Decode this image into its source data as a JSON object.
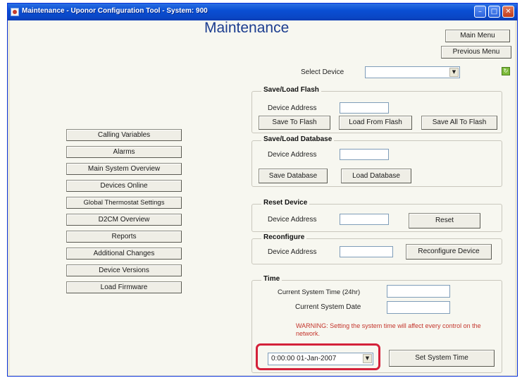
{
  "window": {
    "title": "Maintenance - Uponor Configuration Tool - System: 900"
  },
  "header": {
    "page_title": "Maintenance",
    "main_menu": "Main Menu",
    "previous_menu": "Previous Menu"
  },
  "select_device": {
    "label": "Select Device",
    "value": ""
  },
  "sidebar": {
    "items": [
      {
        "label": "Calling Variables"
      },
      {
        "label": "Alarms"
      },
      {
        "label": "Main System Overview"
      },
      {
        "label": "Devices Online"
      },
      {
        "label": "Global Thermostat Settings"
      },
      {
        "label": "D2CM Overview"
      },
      {
        "label": "Reports"
      },
      {
        "label": "Additional Changes"
      },
      {
        "label": "Device Versions"
      },
      {
        "label": "Load Firmware"
      }
    ]
  },
  "save_load_flash": {
    "title": "Save/Load Flash",
    "address_label": "Device Address",
    "address_value": "",
    "save_to_flash": "Save To Flash",
    "load_from_flash": "Load From Flash",
    "save_all_to_flash": "Save All To Flash"
  },
  "save_load_database": {
    "title": "Save/Load Database",
    "address_label": "Device Address",
    "address_value": "",
    "save_database": "Save Database",
    "load_database": "Load Database"
  },
  "reset_device": {
    "title": "Reset Device",
    "address_label": "Device Address",
    "address_value": "",
    "reset": "Reset"
  },
  "reconfigure": {
    "title": "Reconfigure",
    "address_label": "Device Address",
    "address_value": "",
    "reconfigure_device": "Reconfigure Device"
  },
  "time": {
    "title": "Time",
    "current_time_label": "Current System Time (24hr)",
    "current_time_value": "",
    "current_date_label": "Current System Date",
    "current_date_value": "",
    "warning": "WARNING: Setting the system time will affect every control on the network.",
    "datetime_value": "0:00:00 01-Jan-2007",
    "set_system_time": "Set System Time"
  }
}
